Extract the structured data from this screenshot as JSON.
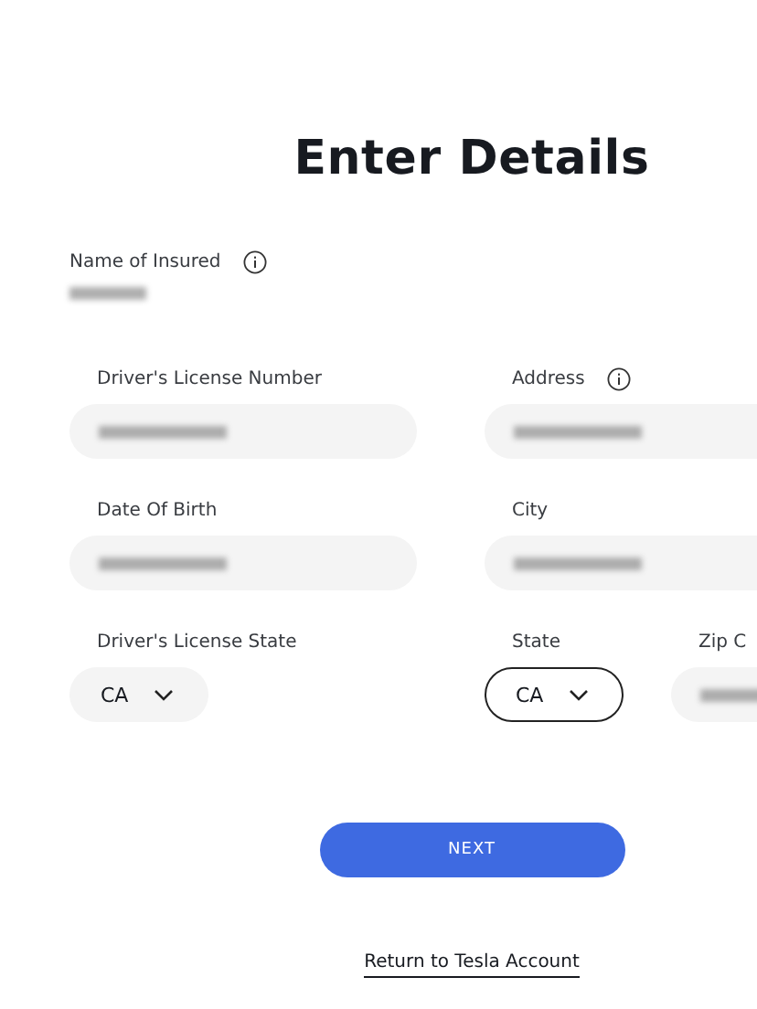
{
  "title": "Enter Details",
  "insured": {
    "label": "Name of Insured",
    "info": true,
    "value_hidden": true
  },
  "fields": [
    {
      "kind": "text",
      "label": "Driver's License Number",
      "info": false,
      "value_hidden": true
    },
    {
      "kind": "text",
      "label": "Address",
      "info": true,
      "value_hidden": true
    },
    {
      "kind": "text",
      "label": "Date Of Birth",
      "info": false,
      "value_hidden": true
    },
    {
      "kind": "text",
      "label": "City",
      "info": false,
      "value_hidden": true
    },
    {
      "kind": "select",
      "label": "Driver's License State",
      "value": "CA",
      "focused": false
    },
    {
      "kind": "pair",
      "items": [
        {
          "kind": "select",
          "label": "State",
          "value": "CA",
          "focused": true
        },
        {
          "kind": "text",
          "label": "Zip C",
          "value_hidden": true
        }
      ]
    }
  ],
  "next_button": "NEXT",
  "return_link": "Return to Tesla Account"
}
